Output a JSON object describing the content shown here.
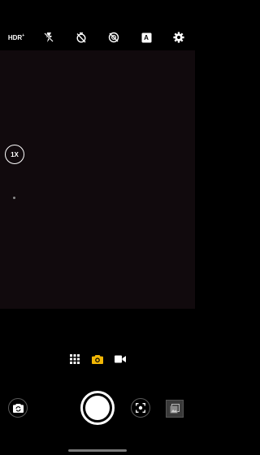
{
  "top_bar": {
    "hdr_label": "HDR",
    "hdr_suffix": "+",
    "icons": [
      "hdr-icon",
      "flash-off-icon",
      "timer-off-icon",
      "filter-off-icon",
      "auto-scene-icon",
      "gear-icon"
    ],
    "auto_label": "A"
  },
  "viewfinder": {
    "zoom_label": "1X"
  },
  "modes": {
    "items": [
      "more-modes-icon",
      "photo-mode-icon",
      "video-mode-icon"
    ],
    "active": "photo-mode-icon"
  },
  "colors": {
    "viewfinder_bg": "#110a0d",
    "active_mode": "#f2b705",
    "icon": "#ffffff"
  }
}
